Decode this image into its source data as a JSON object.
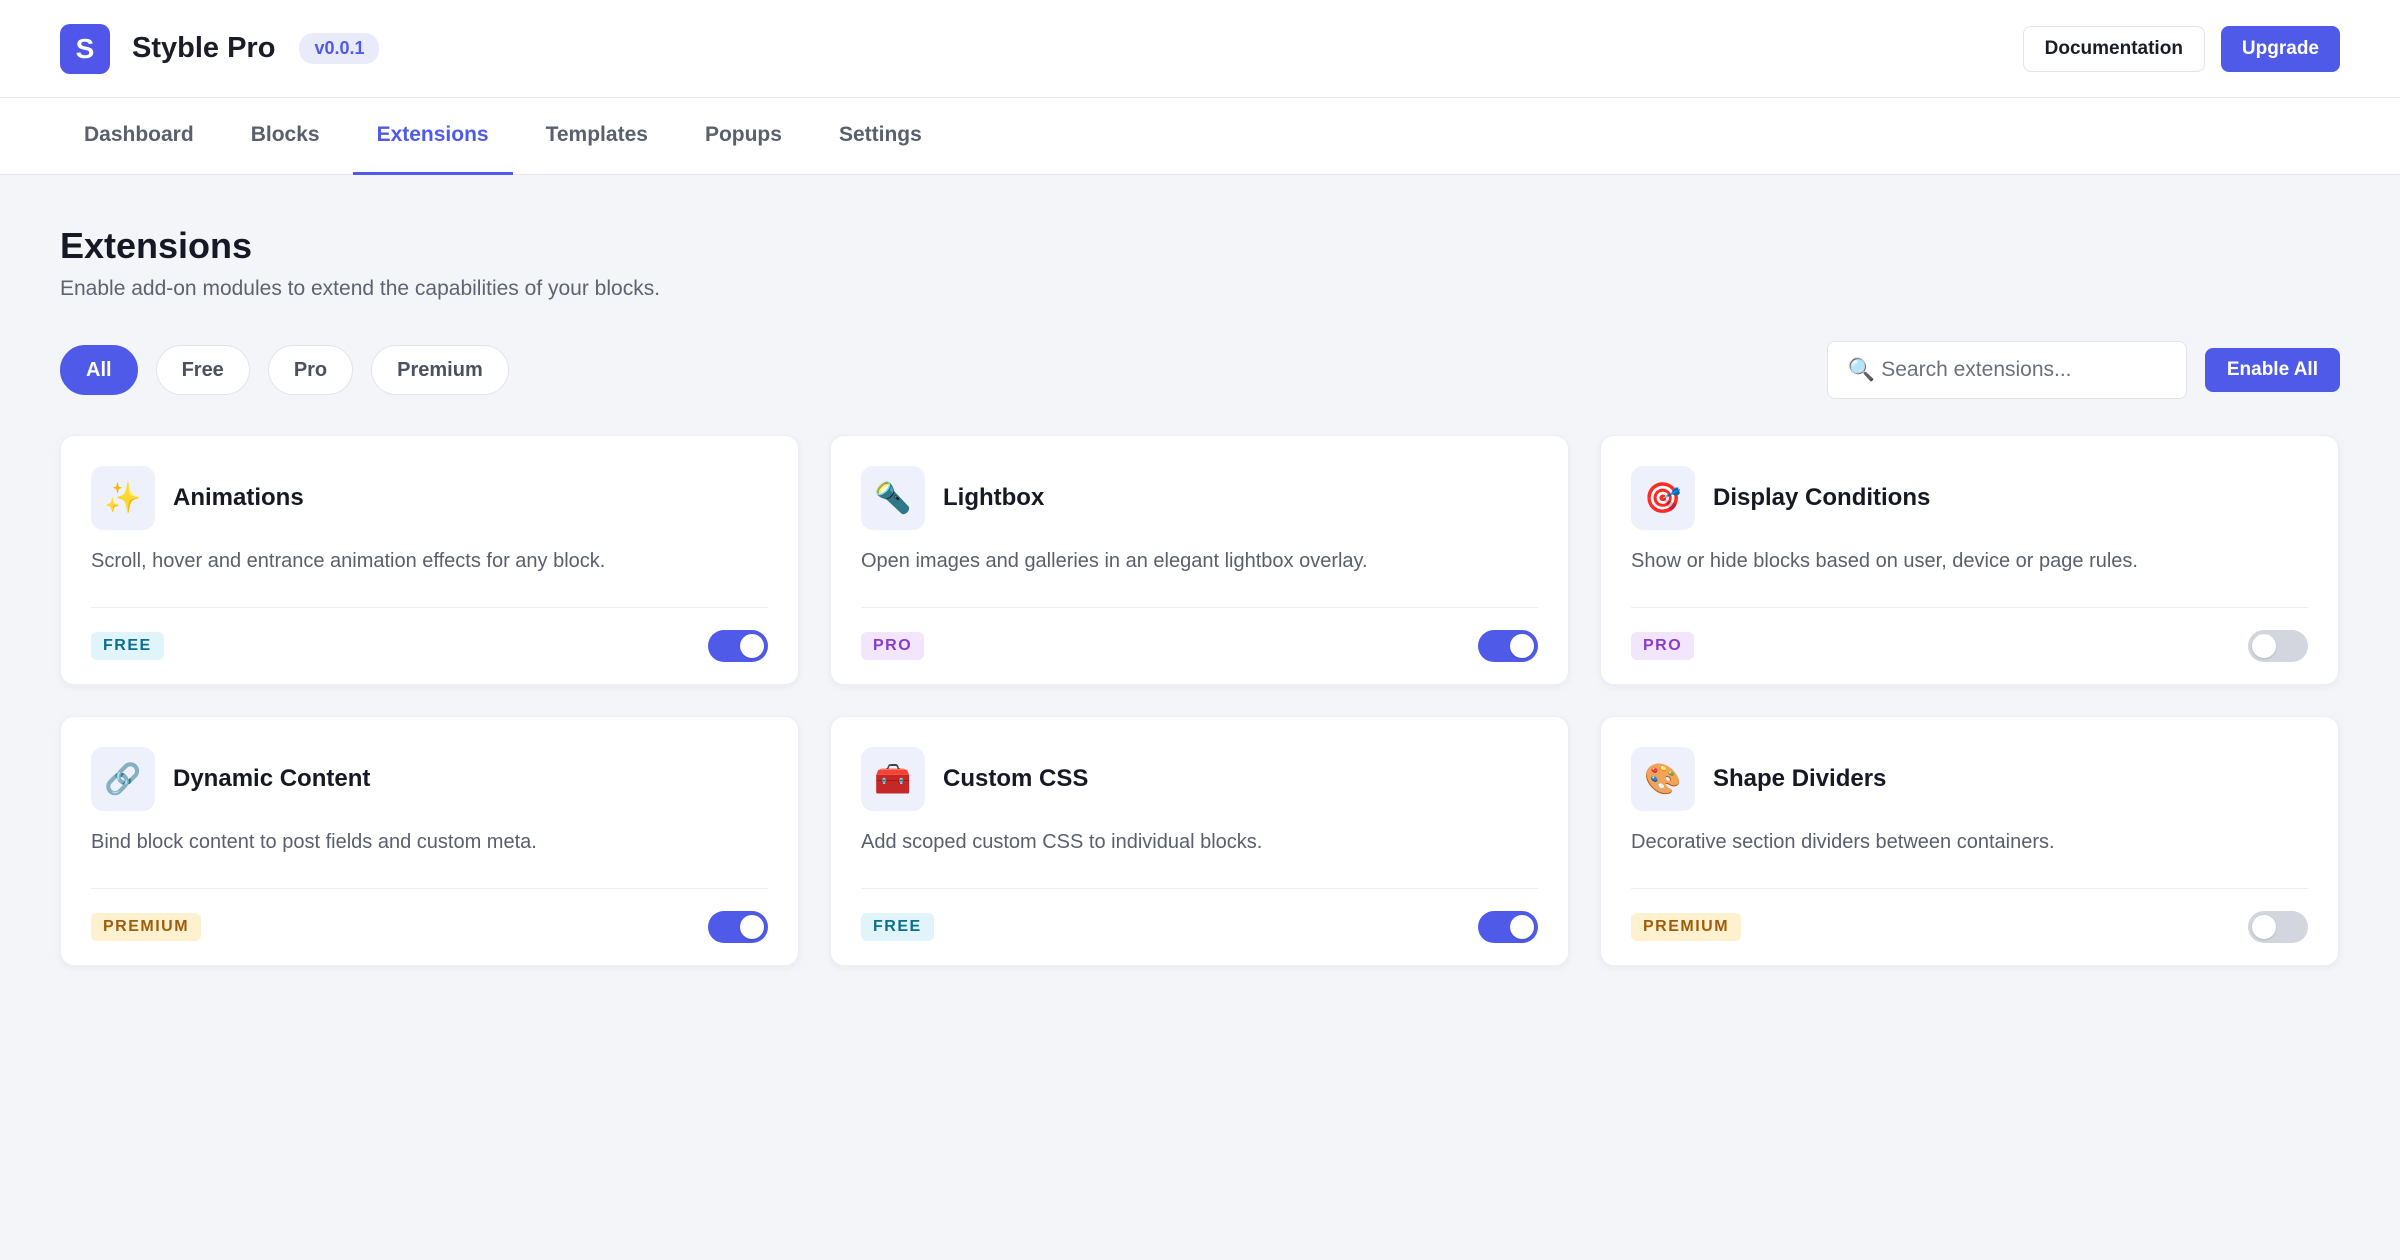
{
  "header": {
    "logo_letter": "S",
    "title": "Styble Pro",
    "version": "v0.0.1",
    "documentation_label": "Documentation",
    "upgrade_label": "Upgrade"
  },
  "tabs": [
    {
      "label": "Dashboard",
      "active": false
    },
    {
      "label": "Blocks",
      "active": false
    },
    {
      "label": "Extensions",
      "active": true
    },
    {
      "label": "Templates",
      "active": false
    },
    {
      "label": "Popups",
      "active": false
    },
    {
      "label": "Settings",
      "active": false
    }
  ],
  "page": {
    "title": "Extensions",
    "subtitle": "Enable add-on modules to extend the capabilities of your blocks."
  },
  "filters": [
    {
      "label": "All",
      "active": true
    },
    {
      "label": "Free",
      "active": false
    },
    {
      "label": "Pro",
      "active": false
    },
    {
      "label": "Premium",
      "active": false
    }
  ],
  "search": {
    "placeholder": "Search extensions...",
    "value": "",
    "icon": "🔍"
  },
  "enable_all_label": "Enable All",
  "extensions": [
    {
      "icon": "✨",
      "icon_name": "sparkles-icon",
      "name": "Animations",
      "description": "Scroll, hover and entrance animation effects for any block.",
      "tier": "FREE",
      "enabled": true
    },
    {
      "icon": "🔦",
      "icon_name": "flashlight-icon",
      "name": "Lightbox",
      "description": "Open images and galleries in an elegant lightbox overlay.",
      "tier": "PRO",
      "enabled": true
    },
    {
      "icon": "🎯",
      "icon_name": "target-icon",
      "name": "Display Conditions",
      "description": "Show or hide blocks based on user, device or page rules.",
      "tier": "PRO",
      "enabled": false
    },
    {
      "icon": "🔗",
      "icon_name": "link-icon",
      "name": "Dynamic Content",
      "description": "Bind block content to post fields and custom meta.",
      "tier": "PREMIUM",
      "enabled": true
    },
    {
      "icon": "🧰",
      "icon_name": "toolbox-icon",
      "name": "Custom CSS",
      "description": "Add scoped custom CSS to individual blocks.",
      "tier": "FREE",
      "enabled": true
    },
    {
      "icon": "🎨",
      "icon_name": "palette-icon",
      "name": "Shape Dividers",
      "description": "Decorative section dividers between containers.",
      "tier": "PREMIUM",
      "enabled": false
    }
  ],
  "colors": {
    "accent": "#4f5be8",
    "logo_bg": "#5056ea",
    "version_text": "#4f5be8",
    "toggle_off": "#d3d6df",
    "badge_free_bg": "#e0f4fa",
    "badge_free_text": "#0b6f8f",
    "badge_pro_bg": "#f1e6fb",
    "badge_pro_text": "#8a3ad0",
    "badge_premium_bg": "#fdf1cf",
    "badge_premium_text": "#a15c0b"
  }
}
